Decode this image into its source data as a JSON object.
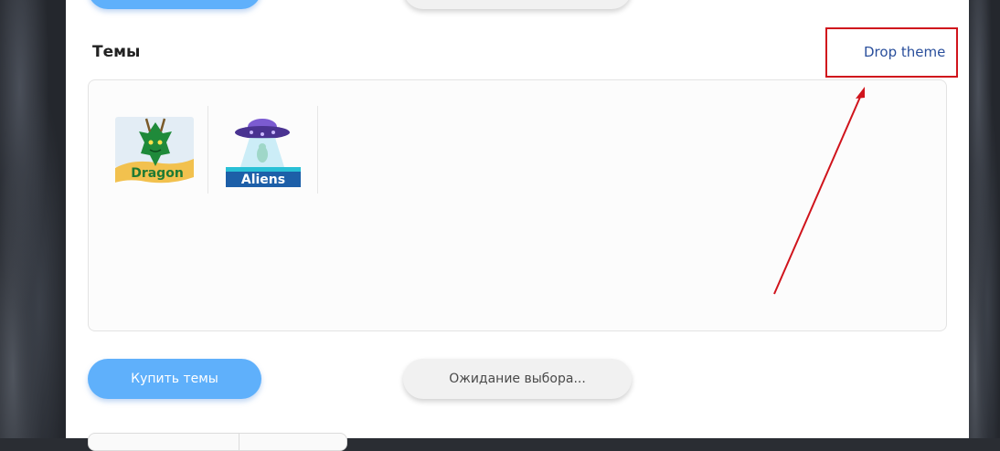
{
  "section": {
    "title": "Темы",
    "drop_link": "Drop theme"
  },
  "themes": [
    {
      "name": "Dragon",
      "label": "Dragon"
    },
    {
      "name": "Aliens",
      "label": "Aliens"
    }
  ],
  "buttons": {
    "buy": "Купить темы",
    "waiting": "Ожидание выбора..."
  },
  "colors": {
    "accent": "#5fb0fb",
    "link": "#2a4f9c",
    "annotation": "#d0141c"
  }
}
